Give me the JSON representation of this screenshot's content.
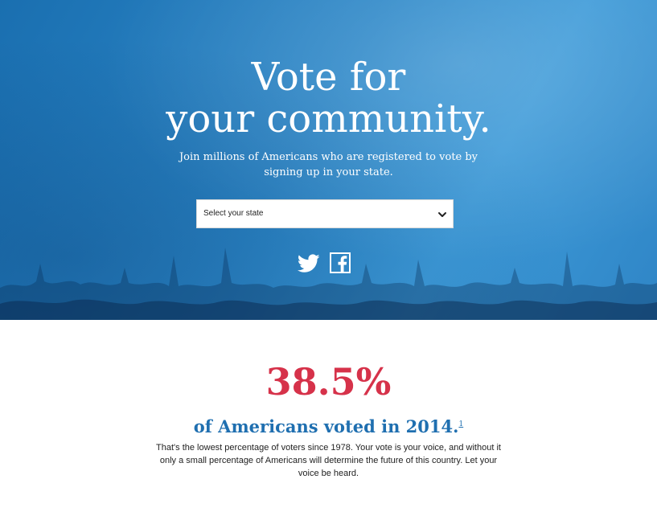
{
  "hero": {
    "title_line1": "Vote for",
    "title_line2": "your community.",
    "subtitle_line1": "Join millions of Americans who are registered to vote by",
    "subtitle_line2": "signing up in your state.",
    "state_select": {
      "selected": "Select your state",
      "icon": "chevron-down-icon"
    },
    "social": {
      "twitter_icon": "twitter-icon",
      "facebook_icon": "facebook-icon"
    },
    "background_color": "#2b86c7"
  },
  "stats": {
    "percent": "38.5%",
    "percent_color": "#d6324a",
    "headline": "of Americans voted in 2014.",
    "footnote_ref": "1",
    "headline_color": "#1f6fb0",
    "body": "That's the lowest percentage of voters since 1978. Your vote is your voice, and without it only a small percentage of Americans will determine the future of this country. Let your voice be heard."
  }
}
